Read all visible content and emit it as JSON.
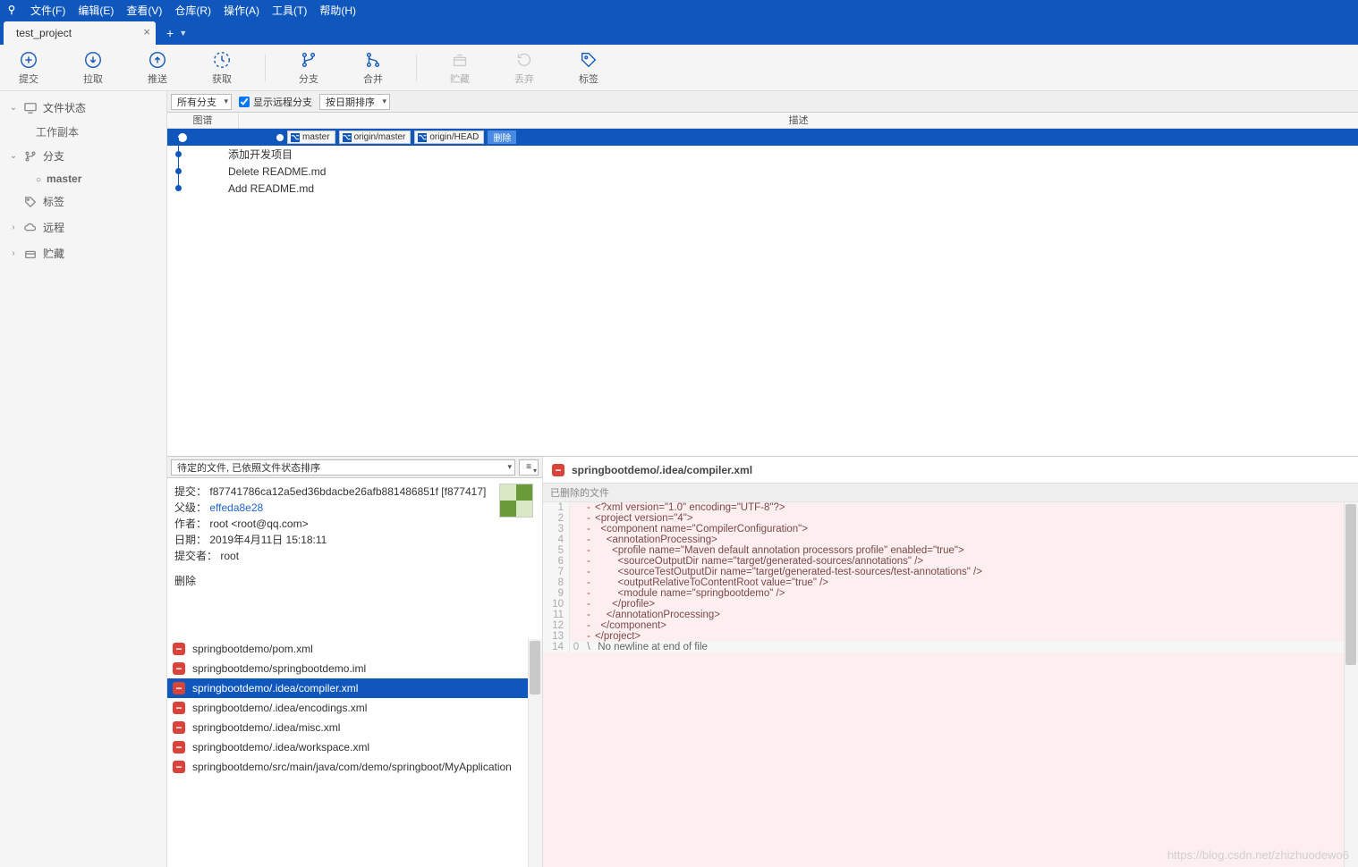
{
  "menu": [
    "文件(F)",
    "编辑(E)",
    "查看(V)",
    "仓库(R)",
    "操作(A)",
    "工具(T)",
    "帮助(H)"
  ],
  "tab": {
    "title": "test_project"
  },
  "toolbar": [
    {
      "id": "commit",
      "label": "提交",
      "icon": "plus-circle"
    },
    {
      "id": "pull",
      "label": "拉取",
      "icon": "arrow-down"
    },
    {
      "id": "push",
      "label": "推送",
      "icon": "arrow-up"
    },
    {
      "id": "fetch",
      "label": "获取",
      "icon": "refresh"
    },
    {
      "id": "sep"
    },
    {
      "id": "branch",
      "label": "分支",
      "icon": "branch"
    },
    {
      "id": "merge",
      "label": "合并",
      "icon": "merge"
    },
    {
      "id": "sep"
    },
    {
      "id": "stash",
      "label": "贮藏",
      "icon": "stash",
      "dim": true
    },
    {
      "id": "discard",
      "label": "丢弃",
      "icon": "discard",
      "dim": true
    },
    {
      "id": "tag",
      "label": "标签",
      "icon": "tag"
    }
  ],
  "sidebar": {
    "filestatus": {
      "label": "文件状态",
      "items": [
        {
          "label": "工作副本"
        }
      ]
    },
    "branches": {
      "label": "分支",
      "items": [
        {
          "label": "master"
        }
      ]
    },
    "tags": {
      "label": "标签"
    },
    "remotes": {
      "label": "远程"
    },
    "stashes": {
      "label": "贮藏"
    }
  },
  "filters": {
    "branchFilter": "所有分支",
    "showRemote": "显示远程分支",
    "sort": "按日期排序"
  },
  "headers": {
    "graph": "图谱",
    "desc": "描述"
  },
  "commits": [
    {
      "badges": [
        "master",
        "origin/master",
        "origin/HEAD"
      ],
      "extra": "删除",
      "selected": true,
      "head": true
    },
    {
      "desc": "添加开发项目"
    },
    {
      "desc": "Delete README.md"
    },
    {
      "desc": "Add README.md"
    }
  ],
  "fileSort": "待定的文件, 已依照文件状态排序",
  "meta": {
    "commitLabel": "提交：",
    "commit": "f87741786ca12a5ed36bdacbe26afb881486851f [f877417]",
    "parentLabel": "父级：",
    "parent": "effeda8e28",
    "authorLabel": "作者：",
    "author": "root <root@qq.com>",
    "dateLabel": "日期：",
    "date": "2019年4月11日 15:18:11",
    "committerLabel": "提交者：",
    "committer": "root",
    "message": "删除"
  },
  "files": [
    "springbootdemo/pom.xml",
    "springbootdemo/springbootdemo.iml",
    "springbootdemo/.idea/compiler.xml",
    "springbootdemo/.idea/encodings.xml",
    "springbootdemo/.idea/misc.xml",
    "springbootdemo/.idea/workspace.xml",
    "springbootdemo/src/main/java/com/demo/springboot/MyApplication"
  ],
  "selectedFileIndex": 2,
  "diff": {
    "filename": "springbootdemo/.idea/compiler.xml",
    "hunk": "已删除的文件",
    "lines": [
      {
        "n": 1,
        "s": "-",
        "t": "<?xml version=\"1.0\" encoding=\"UTF-8\"?>"
      },
      {
        "n": 2,
        "s": "-",
        "t": "<project version=\"4\">"
      },
      {
        "n": 3,
        "s": "-",
        "t": "  <component name=\"CompilerConfiguration\">"
      },
      {
        "n": 4,
        "s": "-",
        "t": "    <annotationProcessing>"
      },
      {
        "n": 5,
        "s": "-",
        "t": "      <profile name=\"Maven default annotation processors profile\" enabled=\"true\">"
      },
      {
        "n": 6,
        "s": "-",
        "t": "        <sourceOutputDir name=\"target/generated-sources/annotations\" />"
      },
      {
        "n": 7,
        "s": "-",
        "t": "        <sourceTestOutputDir name=\"target/generated-test-sources/test-annotations\" />"
      },
      {
        "n": 8,
        "s": "-",
        "t": "        <outputRelativeToContentRoot value=\"true\" />"
      },
      {
        "n": 9,
        "s": "-",
        "t": "        <module name=\"springbootdemo\" />"
      },
      {
        "n": 10,
        "s": "-",
        "t": "      </profile>"
      },
      {
        "n": 11,
        "s": "-",
        "t": "    </annotationProcessing>"
      },
      {
        "n": 12,
        "s": "-",
        "t": "  </component>"
      },
      {
        "n": 13,
        "s": "-",
        "t": "</project>"
      },
      {
        "n": 14,
        "s": "\\",
        "m": "0",
        "t": " No newline at end of file",
        "last": true
      }
    ]
  },
  "watermark": "https://blog.csdn.net/zhizhuodewo6"
}
